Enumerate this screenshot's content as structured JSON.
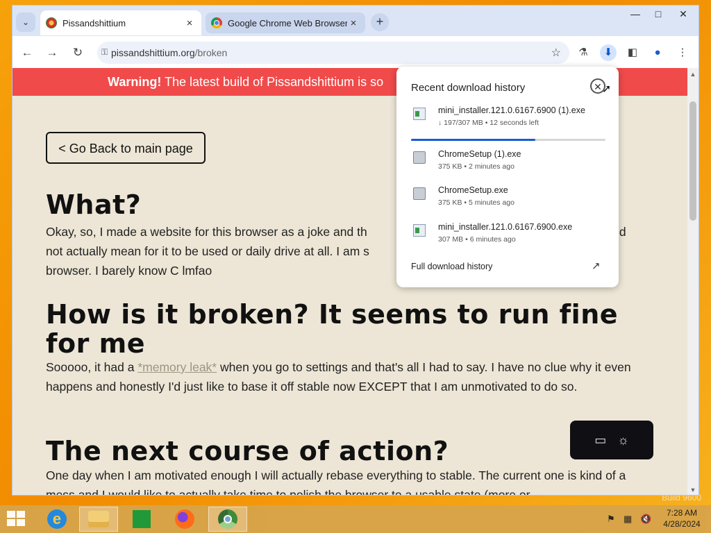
{
  "desktop": {
    "build_text": "Build 9600"
  },
  "browser": {
    "tab_search_icon": "chevron-down-icon",
    "tabs": [
      {
        "title": "Pissandshittium",
        "close": "×"
      },
      {
        "title": "Google Chrome Web Browser",
        "close": "×"
      }
    ],
    "new_tab": "+",
    "window_controls": {
      "min": "—",
      "max": "□",
      "close": "✕"
    },
    "toolbar": {
      "back": "←",
      "forward": "→",
      "reload": "↻",
      "url_domain": "pissandshittium.org",
      "url_path": "/broken",
      "star": "☆",
      "labs": "⚗",
      "download": "⬇",
      "sidepanel": "◧",
      "profile": "●",
      "menu": "⋮"
    }
  },
  "page": {
    "banner_strong": "Warning!",
    "banner_text": " The latest build of Pissandshittium is so",
    "back_button": "< Go Back to main page",
    "h_what": "What?",
    "p_what": "Okay, so, I made a website for this browser as a joke and th",
    "p_what_tail": "id",
    "p_what2": "not actually mean for it to be used or daily drive at all. I am s",
    "p_what3": "browser. I barely know C lmfao",
    "h_broken": "How is it broken? It seems to run fine for me",
    "p_broken_a": "Sooooo, it had a ",
    "p_broken_link": "*memory leak*",
    "p_broken_b": " when you go to settings and that's all I had to say. I have no clue why it even happens and honestly I'd just like to base it off stable now EXCEPT that I am unmotivated to do so.",
    "h_next": "The next course of action?",
    "p_next": "One day when I am motivated enough I will actually rebase everything to stable. The current one is kind of a mess and I would like to actually take time to polish the browser to a usable state (more or",
    "theme_icons": {
      "monitor": "▭",
      "sun": "☼"
    }
  },
  "downloads": {
    "title": "Recent download history",
    "close": "✕",
    "items": [
      {
        "name": "mini_installer.121.0.6167.6900 (1).exe",
        "meta": "↓ 197/307 MB • 12 seconds left",
        "icon": "installer-icon"
      },
      {
        "name": "ChromeSetup (1).exe",
        "meta": "375 KB • 2 minutes ago",
        "icon": "setup-icon"
      },
      {
        "name": "ChromeSetup.exe",
        "meta": "375 KB • 5 minutes ago",
        "icon": "setup-icon"
      },
      {
        "name": "mini_installer.121.0.6167.6900.exe",
        "meta": "307 MB • 6 minutes ago",
        "icon": "installer-icon"
      }
    ],
    "progress": 0.64,
    "full_history": "Full download history",
    "open_icon": "↗"
  },
  "taskbar": {
    "apps": [
      "Internet Explorer",
      "File Explorer",
      "Store",
      "Firefox",
      "Chromium"
    ],
    "time": "7:28 AM",
    "date": "4/28/2024",
    "tray_flag": "⚑",
    "tray_network": "▦",
    "tray_volume": "🔇"
  }
}
